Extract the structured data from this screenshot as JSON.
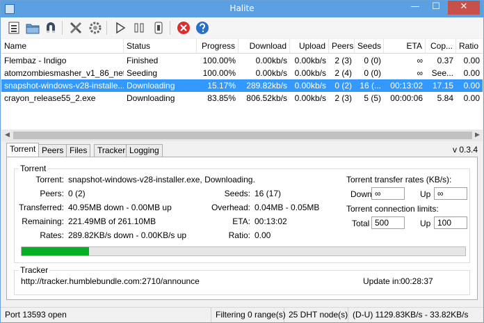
{
  "window": {
    "title": "Halite",
    "min_glyph": "—",
    "max_glyph": "☐",
    "close_glyph": "✕"
  },
  "colors": {
    "selection": "#3399ff",
    "progress_fill": "#06b025",
    "titlebar": "#5ba0e1"
  },
  "toolbar": {
    "icons": [
      "new-torrent-icon",
      "open-folder-icon",
      "magnet-icon",
      "tools-icon",
      "settings-gear-icon",
      "play-icon",
      "pause-icon",
      "stop-icon",
      "remove-icon",
      "help-icon"
    ]
  },
  "list": {
    "columns": [
      "Name",
      "Status",
      "Progress",
      "Download",
      "Upload",
      "Peers",
      "Seeds",
      "ETA",
      "Cop...",
      "Ratio"
    ],
    "rows": [
      {
        "name": "Flembaz - Indigo",
        "status": "Finished",
        "progress": "100.00%",
        "download": "0.00kb/s",
        "upload": "0.00kb/s",
        "peers": "2 (3)",
        "seeds": "0 (0)",
        "eta": "∞",
        "copies": "0.37",
        "ratio": "0.00"
      },
      {
        "name": "atomzombiesmasher_v1_86_net...",
        "status": "Seeding",
        "progress": "100.00%",
        "download": "0.00kb/s",
        "upload": "0.00kb/s",
        "peers": "2 (4)",
        "seeds": "0 (0)",
        "eta": "∞",
        "copies": "See...",
        "ratio": "0.00"
      },
      {
        "name": "snapshot-windows-v28-installe...",
        "status": "Downloading",
        "progress": "15.17%",
        "download": "289.82kb/s",
        "upload": "0.00kb/s",
        "peers": "0 (2)",
        "seeds": "16 (...",
        "eta": "00:13:02",
        "copies": "17.15",
        "ratio": "0.00"
      },
      {
        "name": "crayon_release55_2.exe",
        "status": "Downloading",
        "progress": "83.85%",
        "download": "806.52kb/s",
        "upload": "0.00kb/s",
        "peers": "2 (3)",
        "seeds": "5 (5)",
        "eta": "00:00:06",
        "copies": "5.84",
        "ratio": "0.00"
      }
    ]
  },
  "tabs": [
    "Torrent",
    "Peers",
    "Files",
    "Tracker",
    "Logging"
  ],
  "version": "v 0.3.4",
  "torrent": {
    "group_label": "Torrent",
    "torrent_label": "Torrent:",
    "torrent_value": "snapshot-windows-v28-installer.exe, Downloading.",
    "peers_label": "Peers:",
    "peers_value": "0 (2)",
    "seeds_label": "Seeds:",
    "seeds_value": "16 (17)",
    "transferred_label": "Transferred:",
    "transferred_value": "40.95MB down - 0.00MB up",
    "overhead_label": "Overhead:",
    "overhead_value": "0.04MB - 0.05MB",
    "remaining_label": "Remaining:",
    "remaining_value": "221.49MB of 261.10MB",
    "eta_label": "ETA:",
    "eta_value": "00:13:02",
    "rates_label": "Rates:",
    "rates_value": "289.82KB/s down - 0.00KB/s up",
    "ratio_label": "Ratio:",
    "ratio_value": "0.00",
    "progress_fraction": 0.1517
  },
  "limits": {
    "rates_title": "Torrent transfer rates (KB/s):",
    "down_label": "Down",
    "down_value": "∞",
    "up_label": "Up",
    "up_value": "∞",
    "conn_title": "Torrent connection limits:",
    "total_label": "Total",
    "total_value": "500",
    "conn_up_label": "Up",
    "conn_up_value": "100"
  },
  "tracker": {
    "group_label": "Tracker",
    "url": "http://tracker.humblebundle.com:2710/announce",
    "update_label": "Update in:",
    "update_value": "00:28:37"
  },
  "status": {
    "port": "Port 13593 open",
    "filtering": "Filtering 0 range(s)",
    "dht": "25 DHT node(s)",
    "rates": "(D-U) 1129.83KB/s - 33.82KB/s"
  }
}
